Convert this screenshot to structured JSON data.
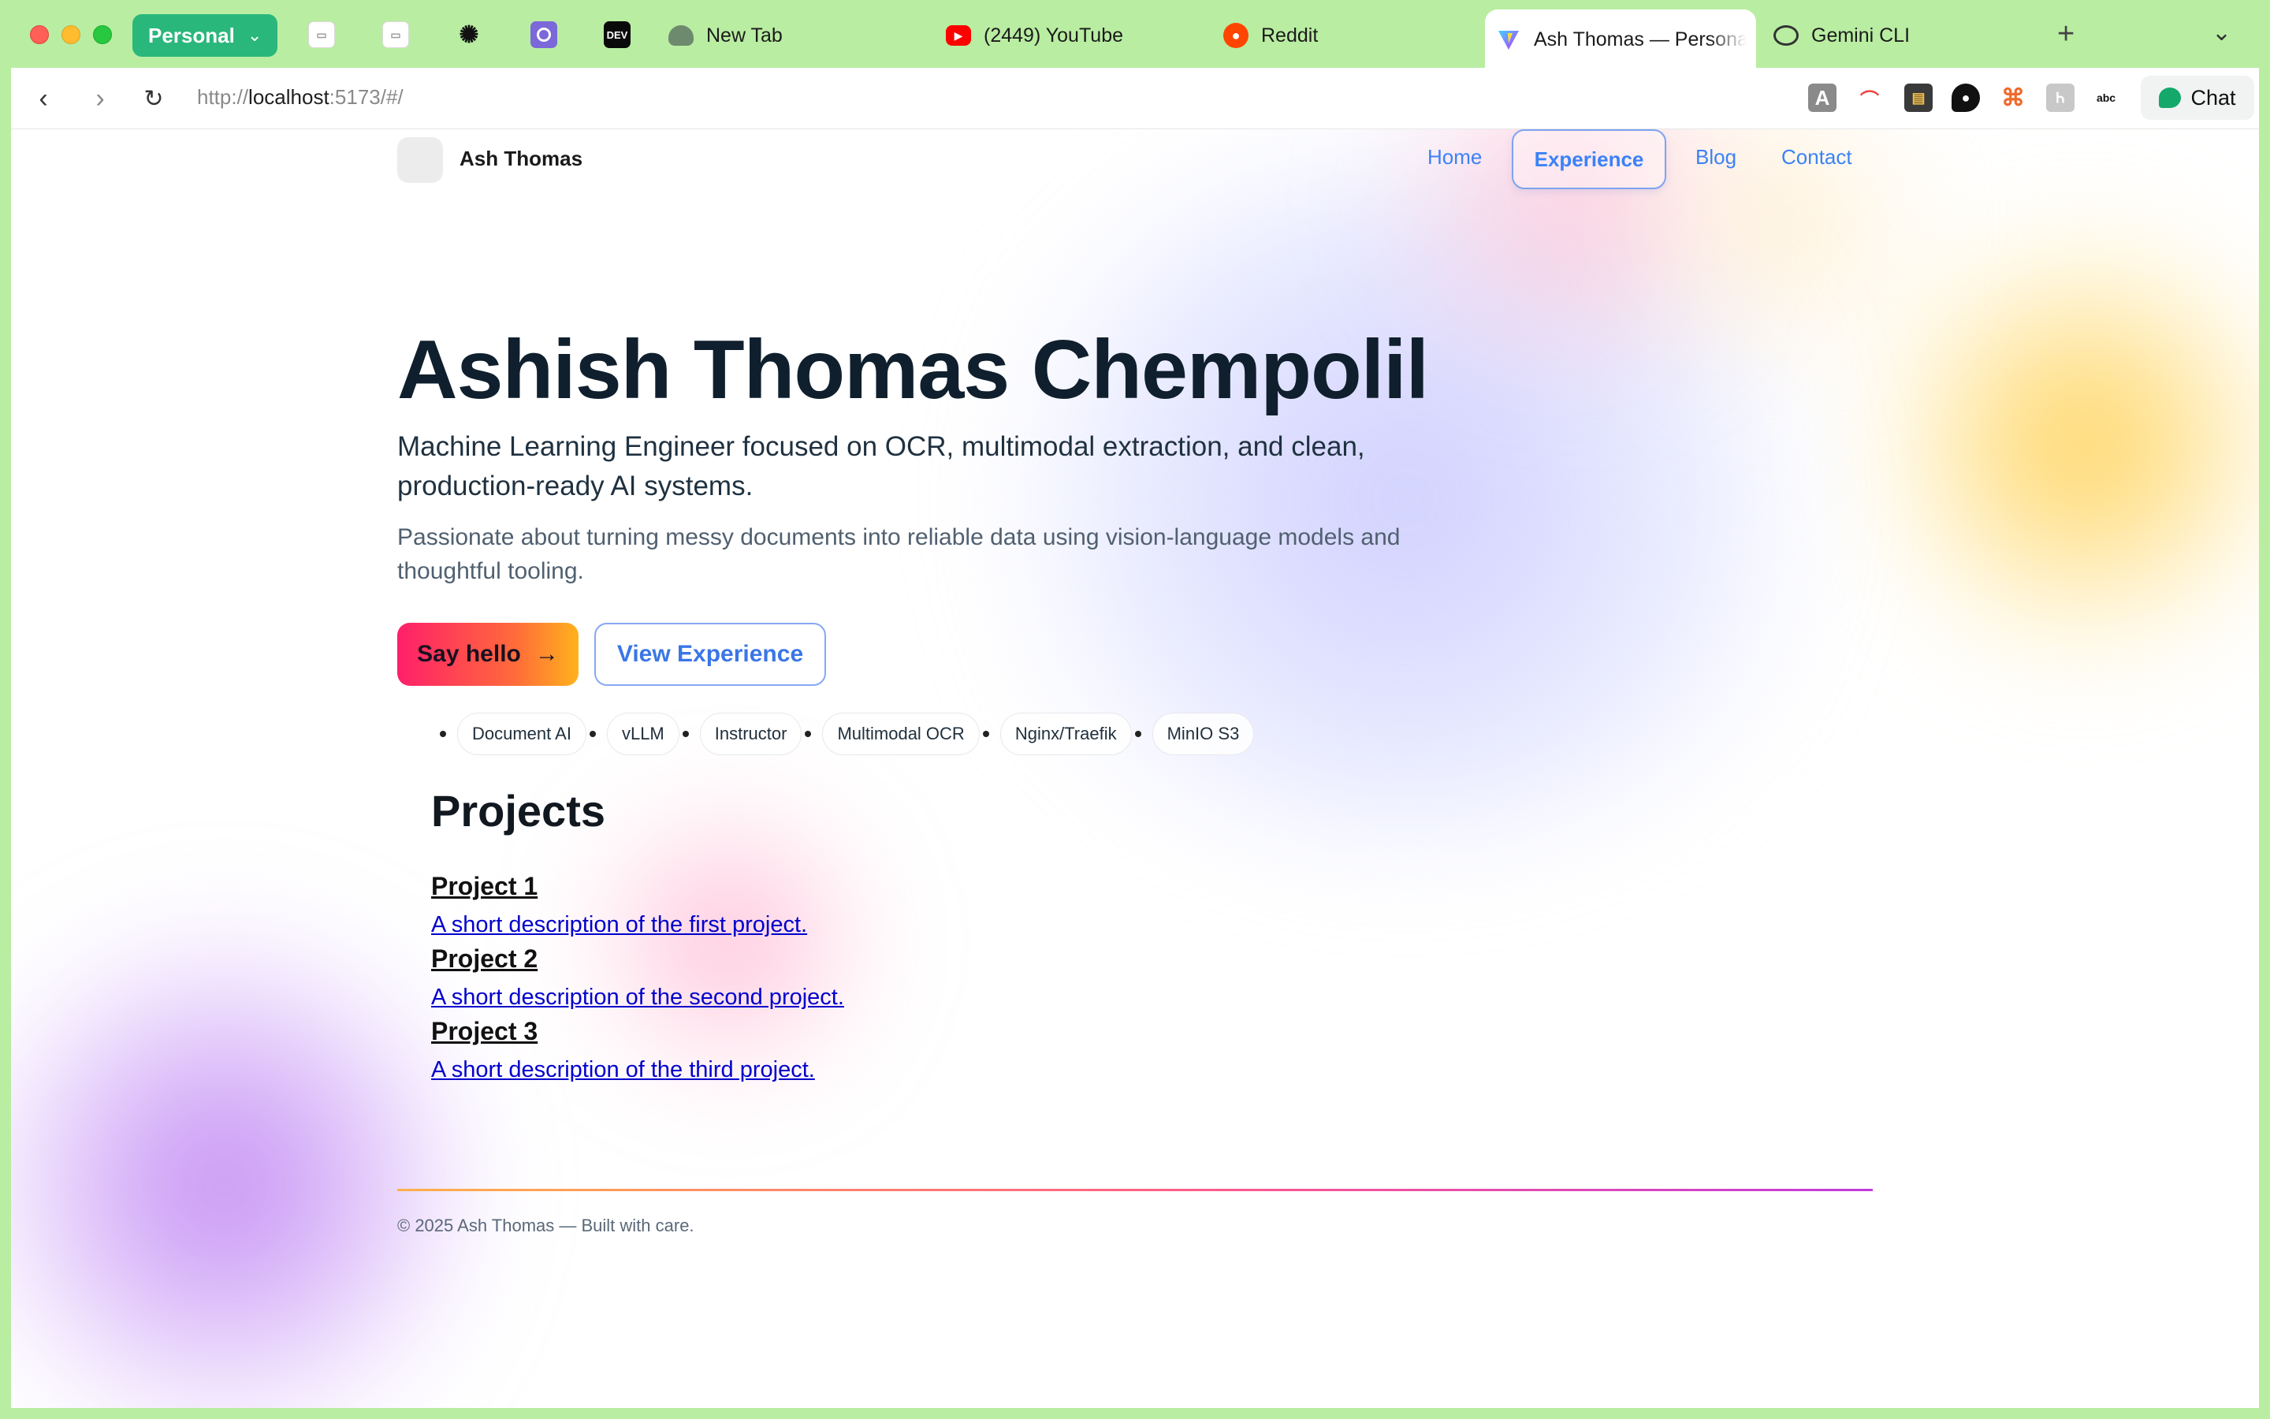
{
  "browser": {
    "profile": "Personal",
    "pinned_tabs": [
      {
        "icon": "generic-page-icon"
      },
      {
        "icon": "generic-page-icon"
      },
      {
        "icon": "openai-icon"
      },
      {
        "icon": "circle-app-icon"
      },
      {
        "icon": "dev-icon",
        "label": "DEV"
      }
    ],
    "tabs": [
      {
        "title": "New Tab",
        "icon": "new-tab-icon"
      },
      {
        "title": "(2449) YouTube",
        "icon": "youtube-icon"
      },
      {
        "title": "Reddit",
        "icon": "reddit-icon"
      },
      {
        "title": "Ash Thomas — Persona",
        "icon": "vite-icon",
        "active": true
      },
      {
        "title": "Gemini CLI",
        "icon": "chat-bubble-icon"
      }
    ],
    "url_scheme": "http://",
    "url_host": "localhost",
    "url_rest": ":5173/#/",
    "chat_label": "Chat",
    "colors": {
      "chrome": "#b9eda2",
      "profile": "#2ab77c",
      "chat_accent": "#14a86b"
    }
  },
  "site": {
    "name": "Ash Thomas",
    "nav": {
      "home": "Home",
      "experience": "Experience",
      "blog": "Blog",
      "contact": "Contact",
      "active": "Experience"
    },
    "hero": {
      "title": "Ashish Thomas Chempolil",
      "subtitle": "Machine Learning Engineer focused on OCR, multimodal extraction, and clean, production-ready AI systems.",
      "description": "Passionate about turning messy documents into reliable data using vision-language models and thoughtful tooling.",
      "cta_primary": "Say hello",
      "cta_primary_icon": "arrow-right-icon",
      "cta_secondary": "View Experience"
    },
    "tags": [
      "Document AI",
      "vLLM",
      "Instructor",
      "Multimodal OCR",
      "Nginx/Traefik",
      "MinIO S3"
    ],
    "projects": {
      "heading": "Projects",
      "items": [
        {
          "name": "Project 1",
          "description": "A short description of the first project."
        },
        {
          "name": "Project 2",
          "description": "A short description of the second project."
        },
        {
          "name": "Project 3",
          "description": "A short description of the third project."
        }
      ]
    },
    "footer": "© 2025 Ash Thomas — Built with care.",
    "colors": {
      "link": "#3b82f6",
      "title": "#0f1f2d",
      "cta_start": "#ff1f6a",
      "cta_end": "#ffb21c"
    }
  }
}
